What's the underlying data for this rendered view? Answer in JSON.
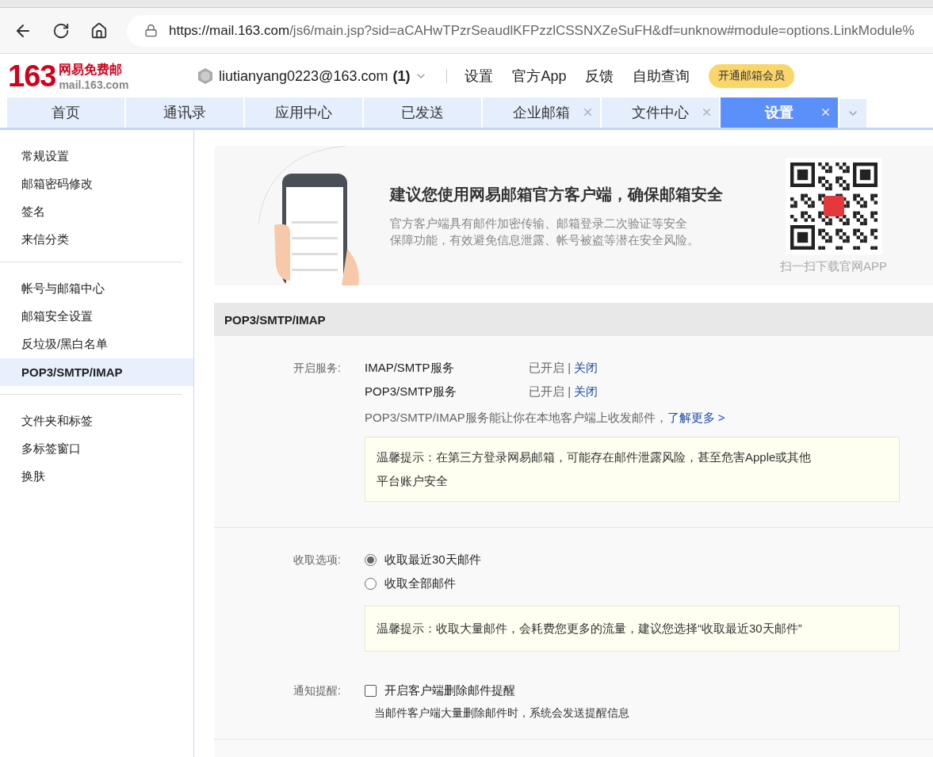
{
  "browser": {
    "url_host": "https://mail.163.com",
    "url_path": "/js6/main.jsp?sid=aCAHwTPzrSeaudlKFPzzlCSSNXZeSuFH&df=unknow#module=options.LinkModule%"
  },
  "header": {
    "logo_number": "163",
    "logo_title": "网易免费邮",
    "logo_domain": "mail.163.com",
    "account": "liutianyang0223@163.com",
    "unread": "(1)",
    "links": [
      "设置",
      "官方App",
      "反馈",
      "自助查询"
    ],
    "vip_button": "开通邮箱会员"
  },
  "tabs": [
    {
      "label": "首页",
      "selected": false,
      "closable": false
    },
    {
      "label": "通讯录",
      "selected": false,
      "closable": false
    },
    {
      "label": "应用中心",
      "selected": false,
      "closable": false
    },
    {
      "label": "已发送",
      "selected": false,
      "closable": false
    },
    {
      "label": "企业邮箱",
      "selected": false,
      "closable": true
    },
    {
      "label": "文件中心",
      "selected": false,
      "closable": true
    },
    {
      "label": "设置",
      "selected": true,
      "closable": true
    }
  ],
  "sidebar": {
    "groups": [
      [
        {
          "label": "常规设置",
          "selected": false
        },
        {
          "label": "邮箱密码修改",
          "selected": false
        },
        {
          "label": "签名",
          "selected": false
        },
        {
          "label": "来信分类",
          "selected": false
        }
      ],
      [
        {
          "label": "帐号与邮箱中心",
          "selected": false
        },
        {
          "label": "邮箱安全设置",
          "selected": false
        },
        {
          "label": "反垃圾/黑白名单",
          "selected": false
        },
        {
          "label": "POP3/SMTP/IMAP",
          "selected": true
        }
      ],
      [
        {
          "label": "文件夹和标签",
          "selected": false
        },
        {
          "label": "多标签窗口",
          "selected": false
        },
        {
          "label": "换肤",
          "selected": false
        }
      ]
    ]
  },
  "banner": {
    "title": "建议您使用网易邮箱官方客户端，确保邮箱安全",
    "text_lines": [
      "官方客户端具有邮件加密传输、邮箱登录二次验证等安全",
      "保障功能，有效避免信息泄露、帐号被盗等潜在安全风险。"
    ],
    "qr_caption": "扫一扫下载官网APP"
  },
  "section_title": "POP3/SMTP/IMAP",
  "services": {
    "label": "开启服务:",
    "items": [
      {
        "name": "IMAP/SMTP服务",
        "status": "已开启",
        "separator": "|",
        "action": "关闭"
      },
      {
        "name": "POP3/SMTP服务",
        "status": "已开启",
        "separator": "|",
        "action": "关闭"
      }
    ],
    "note": "POP3/SMTP/IMAP服务能让你在本地客户端上收发邮件，",
    "learn_more": "了解更多 >",
    "tip_lines": [
      "温馨提示：在第三方登录网易邮箱，可能存在邮件泄露风险，甚至危害Apple或其他",
      "平台账户安全"
    ]
  },
  "fetch": {
    "label": "收取选项:",
    "options": [
      {
        "label": "收取最近30天邮件",
        "selected": true
      },
      {
        "label": "收取全部邮件",
        "selected": false
      }
    ],
    "tip": "温馨提示：收取大量邮件，会耗费您更多的流量，建议您选择“收取最近30天邮件”"
  },
  "notify": {
    "label": "通知提醒:",
    "option": {
      "label": "开启客户端删除邮件提醒",
      "checked": false
    },
    "hint": "当邮件客户端大量删除邮件时，系统会发送提醒信息"
  }
}
